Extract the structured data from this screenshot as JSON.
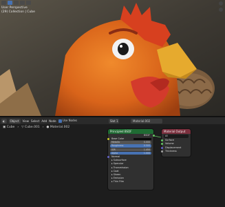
{
  "viewport": {
    "info_line1": "User Perspective",
    "info_line2": "(29) Collection | Cube"
  },
  "header": {
    "editor_mode": "Object",
    "menus": [
      "View",
      "Select",
      "Add",
      "Node"
    ],
    "use_nodes_label": "Use Nodes",
    "slot": "Slot 1",
    "material": "Material.002"
  },
  "breadcrumb": [
    "Cube",
    "Cube.001",
    "Material.002"
  ],
  "bsdf_node": {
    "title": "Principled BSDF",
    "output_label": "BSDF",
    "fields": [
      {
        "label": "Base Color",
        "value": "",
        "style": "color"
      },
      {
        "label": "Metallic",
        "value": "0.000",
        "style": "gray"
      },
      {
        "label": "Roughness",
        "value": "0.500",
        "style": "blue"
      },
      {
        "label": "IOR",
        "value": "1.450",
        "style": "gray"
      },
      {
        "label": "Alpha",
        "value": "1.000",
        "style": "blue"
      }
    ],
    "sections": [
      "Normal",
      "Subsurface",
      "Specular",
      "Transmission",
      "Coat",
      "Sheen",
      "Emission",
      "Thin Film"
    ]
  },
  "output_node": {
    "title": "Material Output",
    "target": "All",
    "inputs": [
      "Surface",
      "Volume",
      "Displacement",
      "Thickness"
    ]
  }
}
